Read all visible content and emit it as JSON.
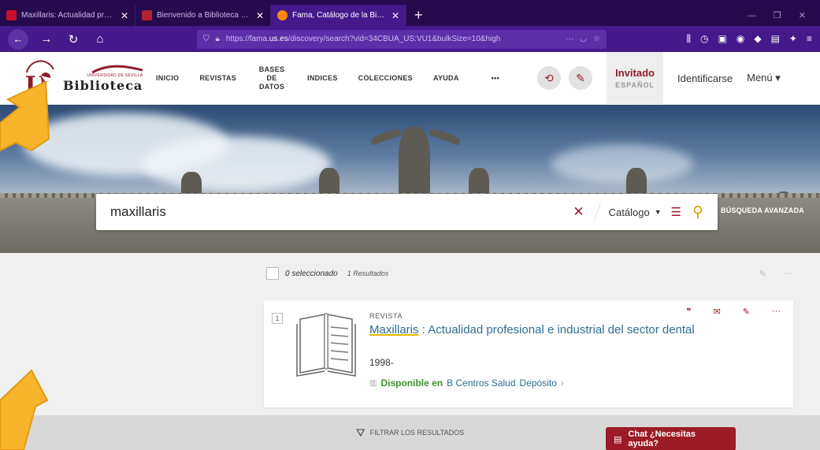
{
  "browser": {
    "tabs": [
      {
        "title": "Maxillaris: Actualidad profesion",
        "active": false,
        "favicon_color": "#c8102e"
      },
      {
        "title": "Bienvenido a Biblioteca Univer",
        "active": false,
        "favicon_color": "#b22234"
      },
      {
        "title": "Fama, Catálogo de la Biblioteca",
        "active": true,
        "favicon_color": "#ff8a00"
      }
    ],
    "url_prefix": "https://fama.",
    "url_domain": "us.es",
    "url_suffix": "/discovery/search?vid=34CBUA_US:VU1&bulkSize=10&high",
    "url_more": "···"
  },
  "header": {
    "logo_small": "UNIVERSIDAD DE SEVILLA",
    "logo_title": "Biblioteca",
    "menu": [
      "INICIO",
      "REVISTAS",
      "BASES DE DATOS",
      "INDICES",
      "COLECCIONES",
      "AYUDA",
      "•••"
    ],
    "guest_name": "Invitado",
    "guest_lang": "ESPAÑOL",
    "login": "Identificarse",
    "menu_button": "Menú"
  },
  "search": {
    "query": "maxillaris",
    "scope": "Catálogo",
    "advanced": "BÚSQUEDA AVANZADA"
  },
  "results": {
    "selected": "0 seleccionado",
    "count": "1 Resultados",
    "items": [
      {
        "number": "1",
        "type": "REVISTA",
        "title_highlight": "Maxillaris",
        "title_rest": " : Actualidad profesional e industrial del sector dental",
        "year": "1998-",
        "available_label": "Disponible en",
        "location1": "B Centros Salud",
        "location2": "Depósito"
      }
    ],
    "filter_label": "FILTRAR LOS RESULTADOS"
  },
  "chat": {
    "label": "Chat ¿Necesitas ayuda?"
  },
  "colors": {
    "accent": "#9b1b26",
    "link": "#2e6d8f",
    "available": "#3f8f2f",
    "browser_bg": "#44198a"
  }
}
